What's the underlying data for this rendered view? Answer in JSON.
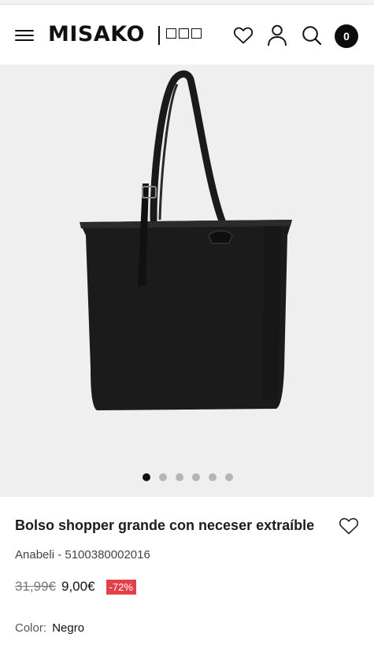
{
  "header": {
    "logo": "MISAKO",
    "cart_count": "0",
    "icons": [
      "menu-icon",
      "language-flags-icon",
      "heart-icon",
      "user-icon",
      "search-icon",
      "cart-icon"
    ]
  },
  "gallery": {
    "slide_count": 6,
    "active_slide": 1,
    "background": "#efefef"
  },
  "product": {
    "title": "Bolso shopper grande con neceser extraíble",
    "reference": "Anabeli - 5100380002016",
    "old_price": "31,99€",
    "price": "9,00€",
    "discount": "-72%",
    "color_label": "Color:",
    "color_value": "Negro"
  },
  "colors": {
    "accent": "#e2404b",
    "text": "#1c1c1c",
    "cart_badge": "#0c0c0c"
  }
}
